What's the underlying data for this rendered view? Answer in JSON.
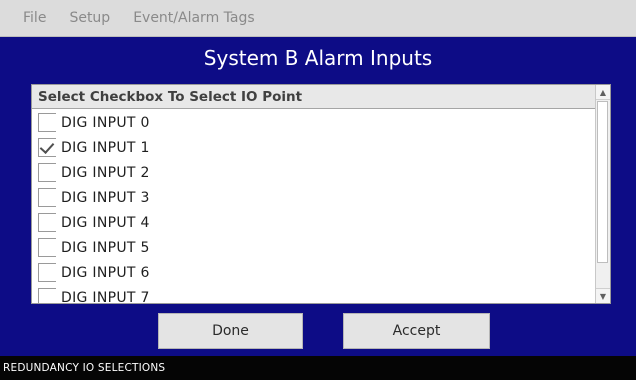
{
  "menu": {
    "items": [
      "File",
      "Setup",
      "Event/Alarm Tags"
    ]
  },
  "title": "System B Alarm Inputs",
  "list": {
    "header": "Select Checkbox To Select IO Point",
    "items": [
      {
        "label": "DIG INPUT 0",
        "checked": false
      },
      {
        "label": "DIG INPUT 1",
        "checked": true
      },
      {
        "label": "DIG INPUT 2",
        "checked": false
      },
      {
        "label": "DIG INPUT 3",
        "checked": false
      },
      {
        "label": "DIG INPUT 4",
        "checked": false
      },
      {
        "label": "DIG INPUT 5",
        "checked": false
      },
      {
        "label": "DIG INPUT 6",
        "checked": false
      },
      {
        "label": "DIG INPUT 7",
        "checked": false
      }
    ]
  },
  "buttons": {
    "done": "Done",
    "accept": "Accept"
  },
  "status": "REDUNDANCY IO SELECTIONS",
  "icons": {
    "scroll_up": "arrow-up-icon",
    "scroll_down": "arrow-down-icon"
  }
}
